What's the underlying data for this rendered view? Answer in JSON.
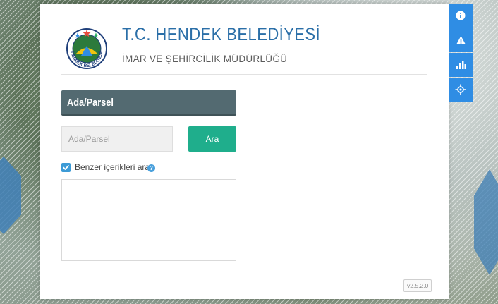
{
  "header": {
    "title": "T.C. HENDEK BELEDİYESİ",
    "subtitle": "İMAR VE ŞEHİRCİLİK MÜDÜRLÜĞÜ",
    "logo_text": "HENDEK BELEDİYESİ"
  },
  "search": {
    "section_title": "Ada/Parsel",
    "placeholder": "Ada/Parsel",
    "value": "",
    "button_label": "Ara",
    "similar_checkbox_label": "Benzer içerikleri ara",
    "similar_checked": true,
    "help_glyph": "?"
  },
  "footer": {
    "version": "v2.5.2.0"
  },
  "toolbar": {
    "buttons": [
      {
        "icon": "info-icon"
      },
      {
        "icon": "warning-icon"
      },
      {
        "icon": "bar-chart-icon"
      },
      {
        "icon": "crosshair-icon"
      }
    ]
  },
  "colors": {
    "accent_blue": "#2f8de4",
    "title_blue": "#2b6fa8",
    "header_slate": "#536a71",
    "button_green": "#1fae8c"
  }
}
